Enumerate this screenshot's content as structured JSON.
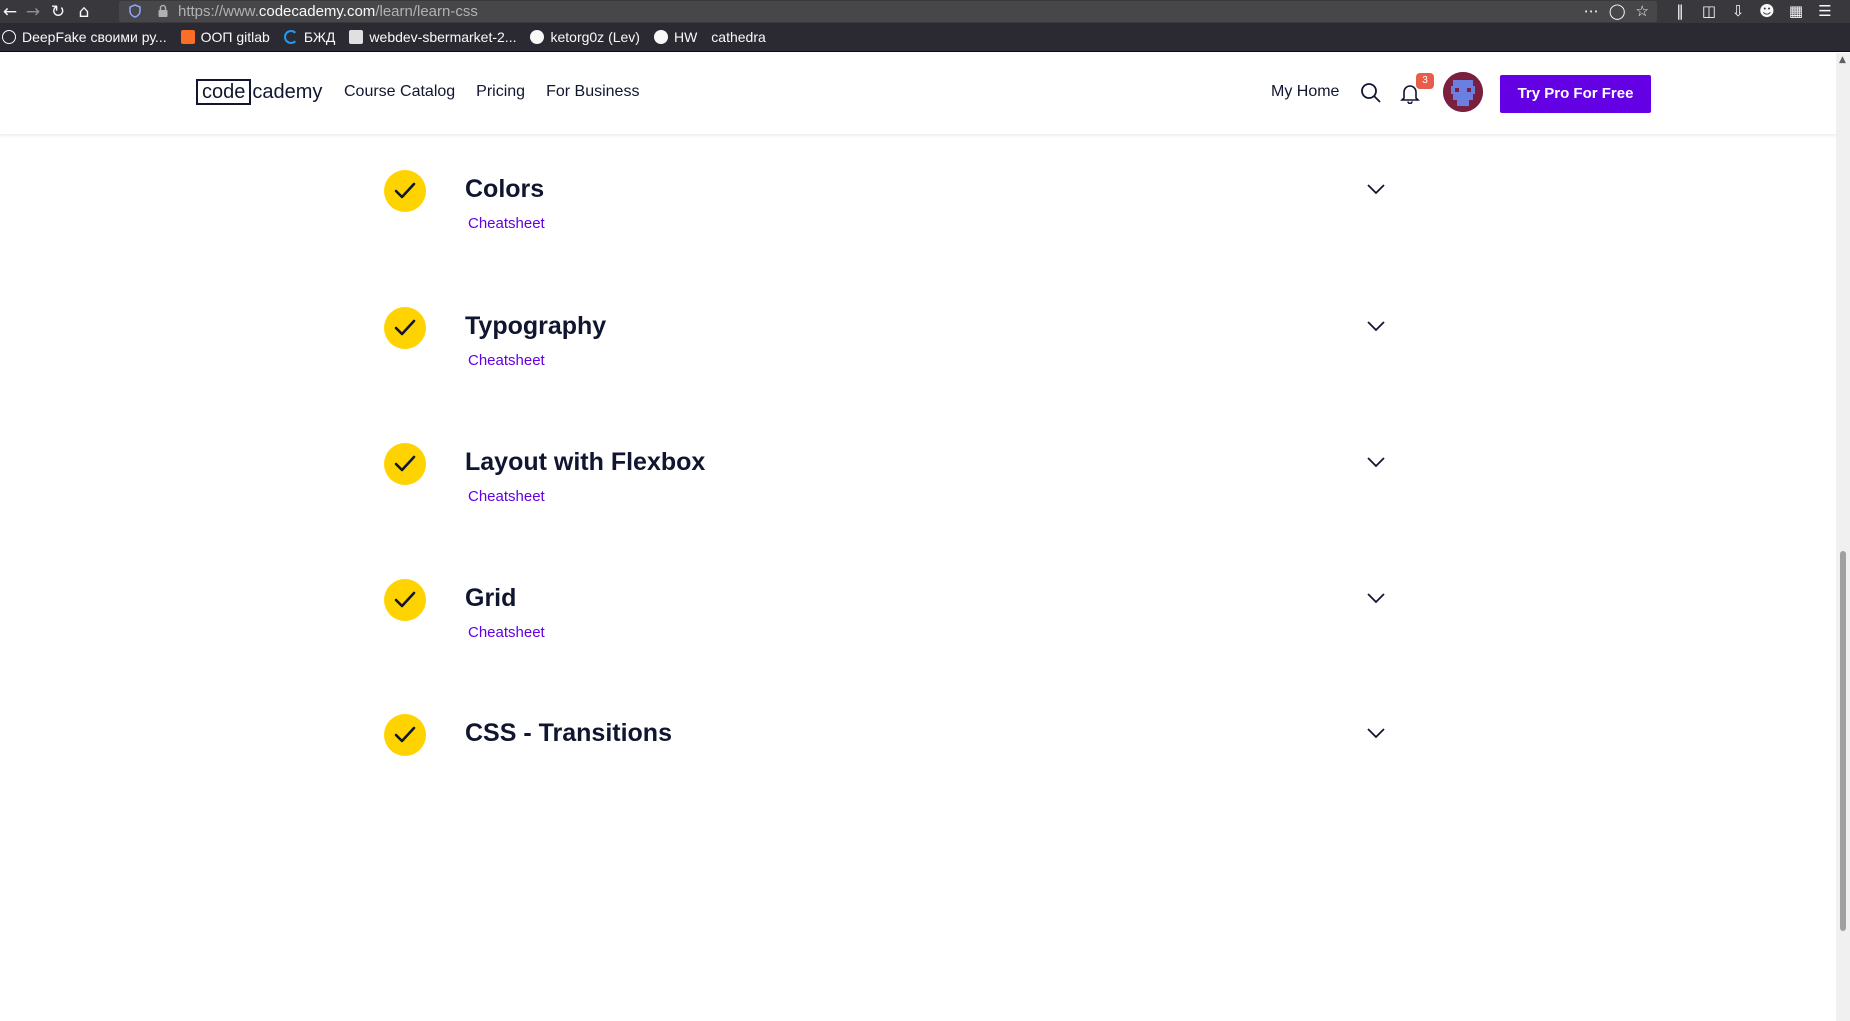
{
  "browser": {
    "url_prefix": "https://www.",
    "url_domain": "codecademy.com",
    "url_path": "/learn/learn-css",
    "bookmarks": [
      {
        "label": "DeepFake своими ру...",
        "icon": "globe-icon"
      },
      {
        "label": "ООП gitlab",
        "icon": "gitlab-icon"
      },
      {
        "label": "БЖД",
        "icon": "spinner-icon"
      },
      {
        "label": "webdev-sbermarket-2...",
        "icon": "trello-icon"
      },
      {
        "label": "ketorg0z (Lev)",
        "icon": "github-icon"
      },
      {
        "label": "HW",
        "icon": "github-icon"
      },
      {
        "label": "cathedra",
        "icon": ""
      }
    ]
  },
  "header": {
    "logo_boxed": "code",
    "logo_rest": "cademy",
    "nav": [
      "Course Catalog",
      "Pricing",
      "For Business"
    ],
    "my_home": "My Home",
    "notification_count": "3",
    "cta": "Try Pro For Free"
  },
  "modules": [
    {
      "title": "Colors",
      "link": "Cheatsheet"
    },
    {
      "title": "Typography",
      "link": "Cheatsheet"
    },
    {
      "title": "Layout with Flexbox",
      "link": "Cheatsheet"
    },
    {
      "title": "Grid",
      "link": "Cheatsheet"
    },
    {
      "title": "CSS - Transitions",
      "link": ""
    }
  ],
  "colors": {
    "brand_purple": "#6400e4",
    "check_yellow": "#ffd300",
    "text_navy": "#10162f",
    "badge_red": "#e85d4a"
  }
}
